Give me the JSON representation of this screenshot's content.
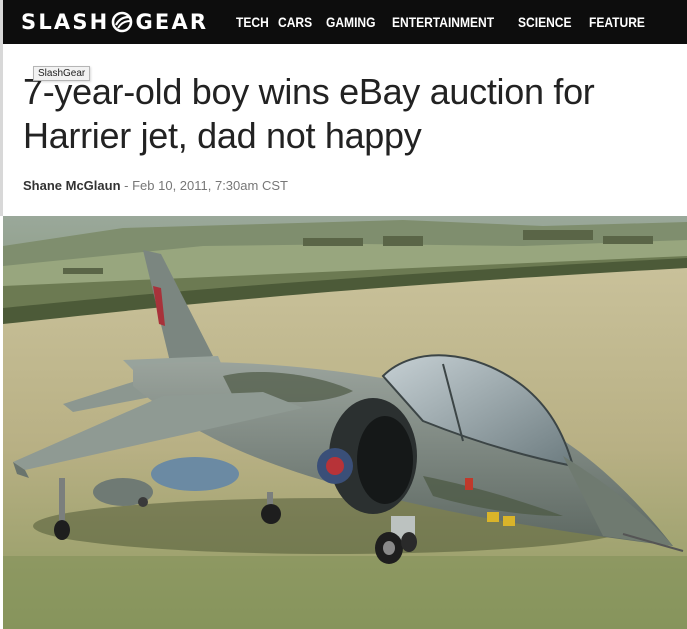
{
  "site": {
    "logo_left": "SLASH",
    "logo_right": "GEAR",
    "nav": [
      "TECH",
      "CARS",
      "GAMING",
      "ENTERTAINMENT",
      "SCIENCE",
      "FEATURE"
    ]
  },
  "article": {
    "title": "7-year-old boy wins eBay auction for Harrier jet, dad not happy",
    "tooltip": "SlashGear",
    "author": "Shane McGlaun",
    "separator": " - ",
    "date": "Feb 10, 2011, 7:30am CST"
  },
  "colors": {
    "topbar": "#0d0d0d",
    "title_text": "#222222",
    "byline_text": "#777777"
  },
  "photo": {
    "subject": "harrier-jet-on-grass-field",
    "roundel_icon": "raf-roundel-icon"
  }
}
